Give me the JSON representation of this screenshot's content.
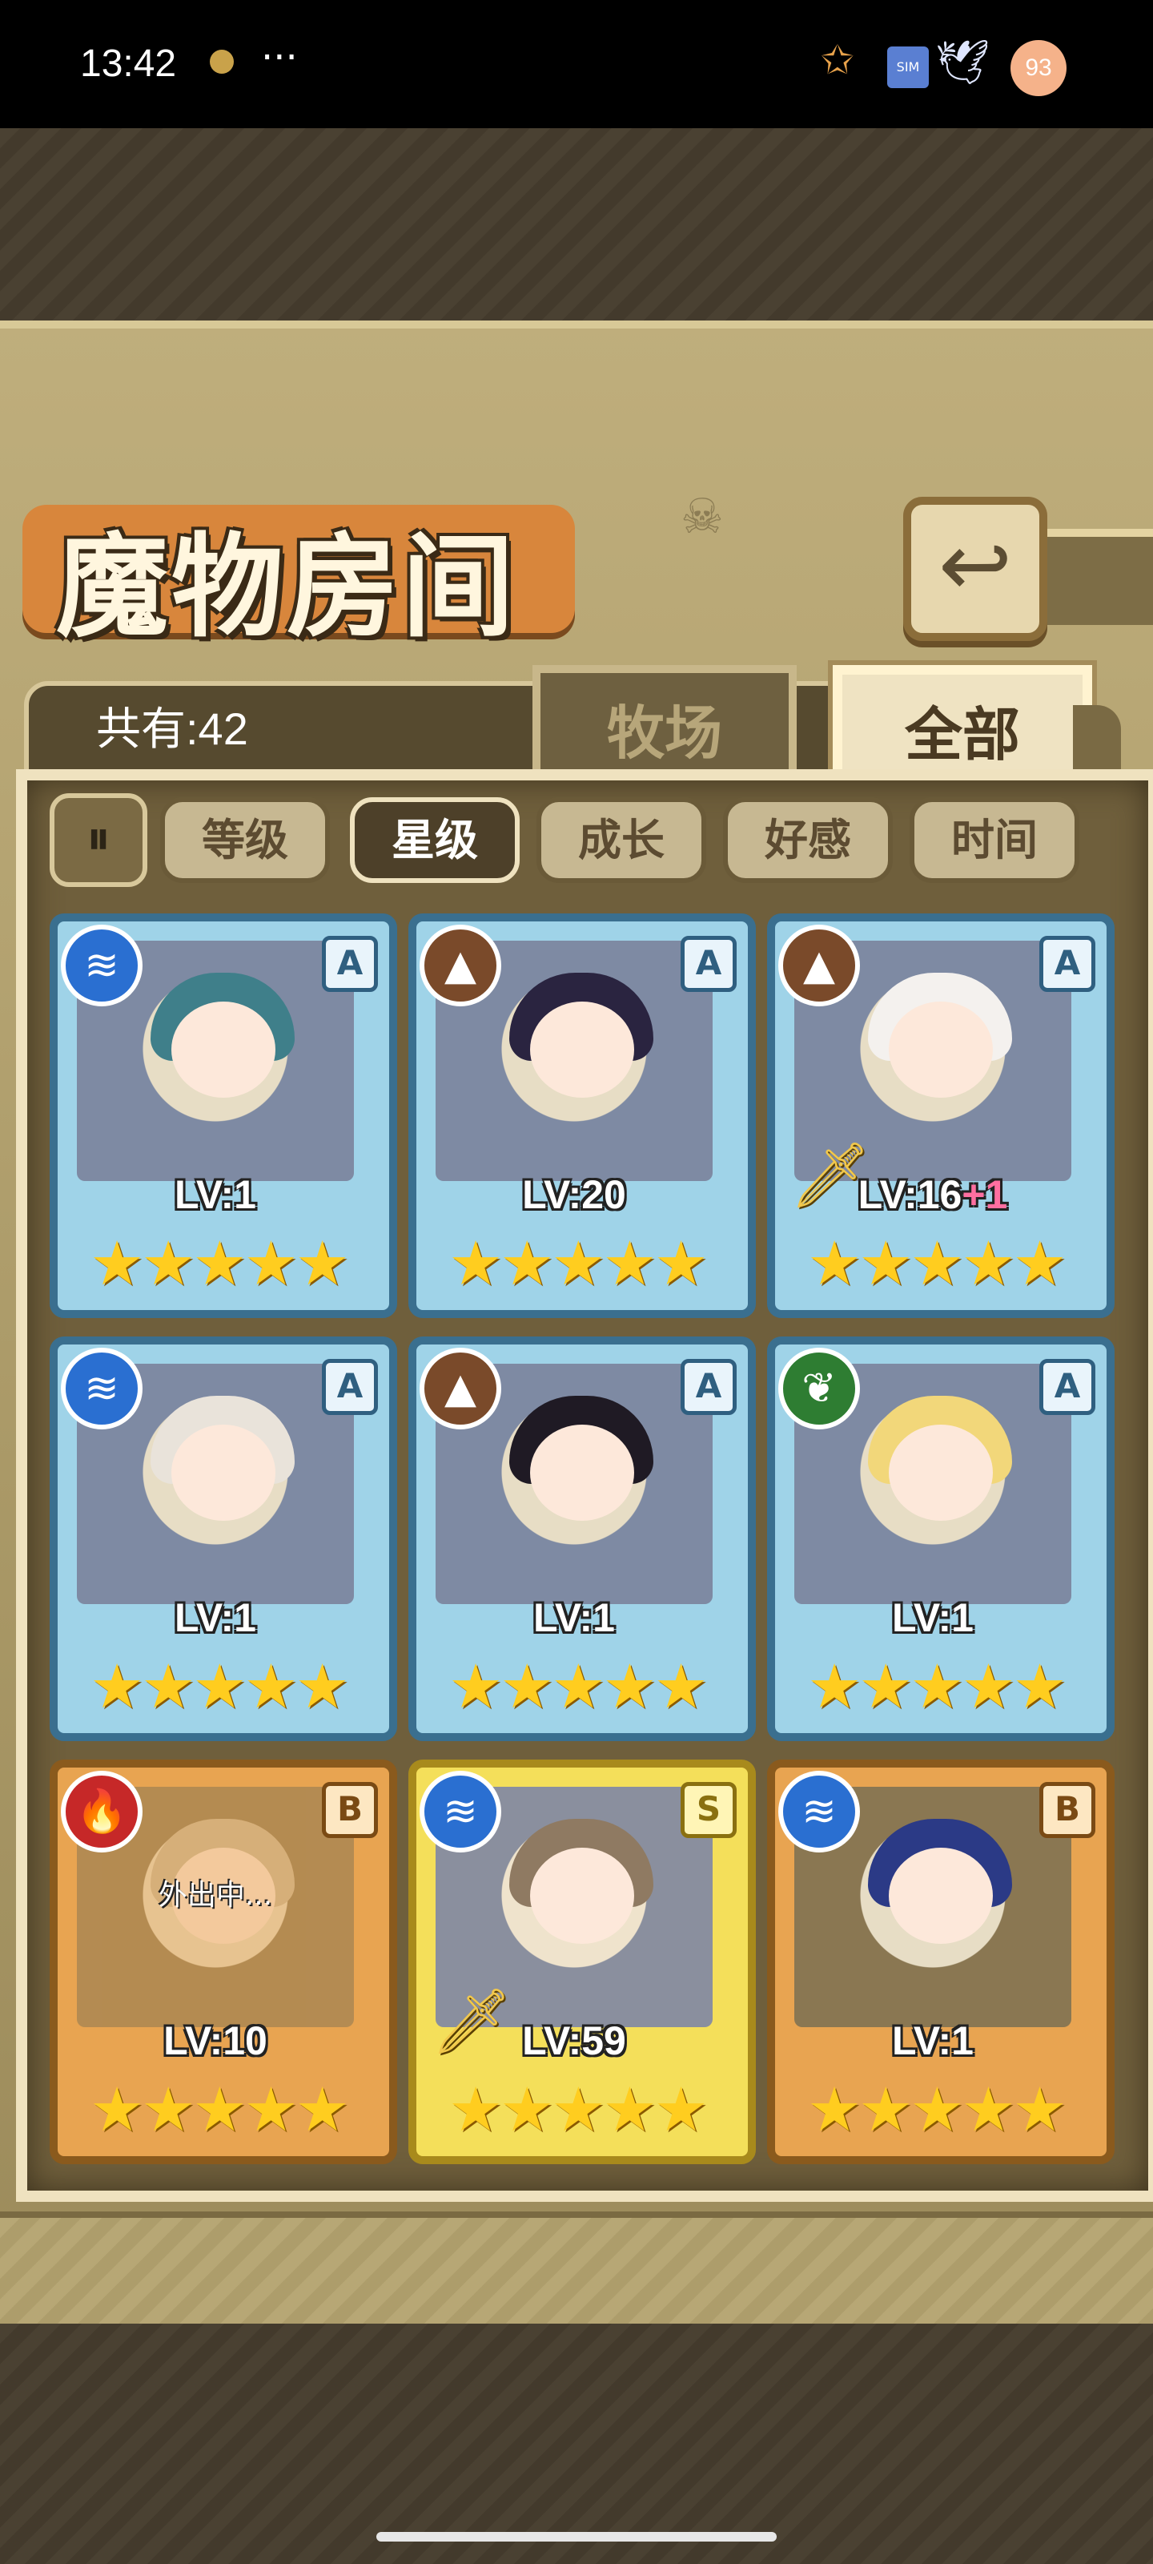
{
  "status_bar": {
    "time": "13:42",
    "dots": "···",
    "badge": "93",
    "icons": [
      "app-notification-icon",
      "star-icon",
      "sim-icon",
      "bird-icon"
    ]
  },
  "title": "魔物房间",
  "back_icon": "↩",
  "count_label": "共有:42",
  "tabs": [
    {
      "label": "牧场",
      "active": false
    },
    {
      "label": "全部",
      "active": true
    }
  ],
  "sort_toggle_icon": "⏸",
  "sort_buttons": [
    {
      "label": "等级",
      "active": false
    },
    {
      "label": "星级",
      "active": true
    },
    {
      "label": "成长",
      "active": false
    },
    {
      "label": "好感",
      "active": false
    },
    {
      "label": "时间",
      "active": false
    }
  ],
  "cards": [
    {
      "level": "LV:1",
      "plus": "",
      "grade": "A",
      "element": "water",
      "frame": "blue",
      "stars": 5,
      "away": "",
      "equipped": false,
      "hair": "#3f7f8a"
    },
    {
      "level": "LV:20",
      "plus": "",
      "grade": "A",
      "element": "earth",
      "frame": "blue",
      "stars": 5,
      "away": "",
      "equipped": false,
      "hair": "#2a2440"
    },
    {
      "level": "LV:16",
      "plus": "+1",
      "grade": "A",
      "element": "earth",
      "frame": "blue",
      "stars": 5,
      "away": "",
      "equipped": true,
      "hair": "#f4f1ee"
    },
    {
      "level": "LV:1",
      "plus": "",
      "grade": "A",
      "element": "water",
      "frame": "blue",
      "stars": 5,
      "away": "",
      "equipped": false,
      "hair": "#e9e3da"
    },
    {
      "level": "LV:1",
      "plus": "",
      "grade": "A",
      "element": "earth",
      "frame": "blue",
      "stars": 5,
      "away": "",
      "equipped": false,
      "hair": "#1f1a24"
    },
    {
      "level": "LV:1",
      "plus": "",
      "grade": "A",
      "element": "nature",
      "frame": "blue",
      "stars": 5,
      "away": "",
      "equipped": false,
      "hair": "#f2d77a"
    },
    {
      "level": "LV:10",
      "plus": "",
      "grade": "B",
      "element": "fire",
      "frame": "orange",
      "stars": 5,
      "away": "外出中...",
      "equipped": false,
      "hair": "#c9b89a"
    },
    {
      "level": "LV:59",
      "plus": "",
      "grade": "S",
      "element": "water",
      "frame": "gold",
      "stars": 5,
      "away": "",
      "equipped": true,
      "hair": "#8f7a62"
    },
    {
      "level": "LV:1",
      "plus": "",
      "grade": "B",
      "element": "water",
      "frame": "orange",
      "stars": 5,
      "away": "",
      "equipped": false,
      "hair": "#2b3a86"
    }
  ]
}
